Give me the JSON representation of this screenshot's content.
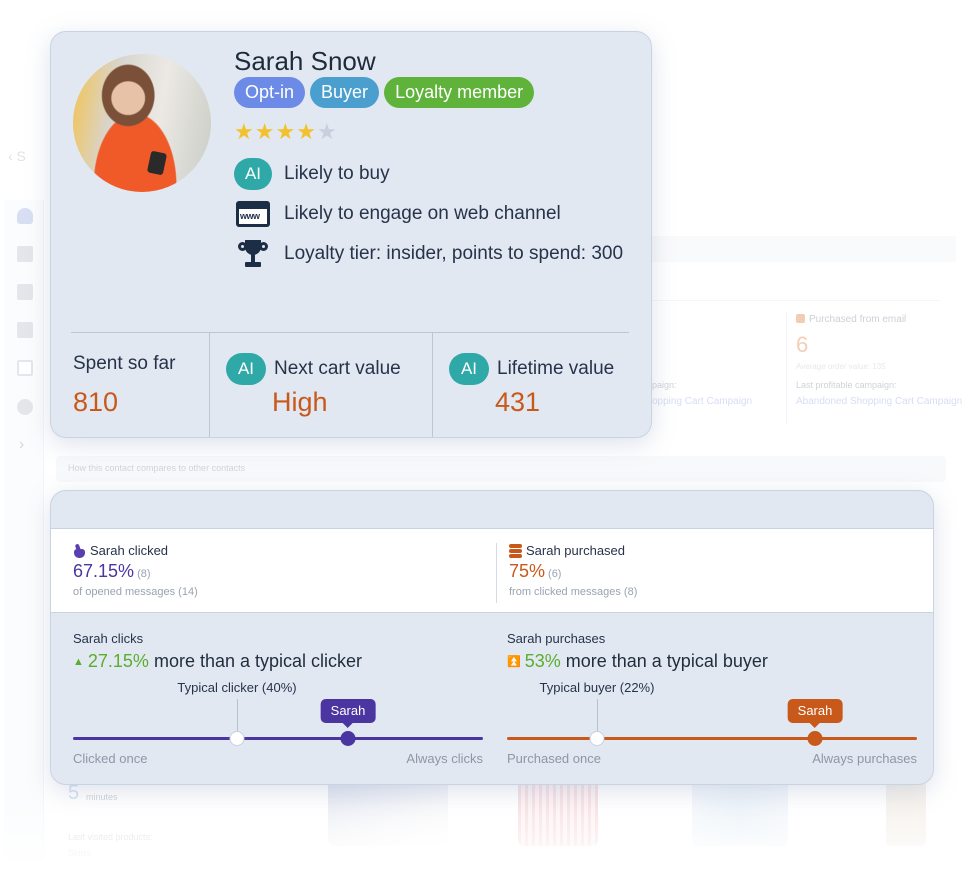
{
  "background": {
    "back_glyph": "‹ S",
    "sidebar_icons": [
      "contact-icon",
      "document-check-icon",
      "photo-document-icon",
      "building-icon",
      "file-text-icon",
      "globe-icon"
    ],
    "sidebar_expand": "›",
    "purchased_from_email": {
      "label": "Purchased from email",
      "value": "6",
      "avg_order": "Average order value: 135"
    },
    "last_profitable_campaign_label": "Last profitable campaign:",
    "last_profitable_campaign": "Abandoned Shopping Cart Campaign",
    "left_campaign_label": "paign:",
    "left_campaign": "opping Cart Campaign",
    "compare_heading": "How this contact compares to other contacts",
    "session": {
      "value": "5",
      "unit": "minutes"
    },
    "last_visited_label": "Last visited products:",
    "last_visited_category": "Skirts"
  },
  "profile": {
    "name": "Sarah Snow",
    "badges": [
      {
        "label": "Opt-in",
        "color": "#6c8be6"
      },
      {
        "label": "Buyer",
        "color": "#4a9fcf"
      },
      {
        "label": "Loyalty member",
        "color": "#5fb33a"
      }
    ],
    "rating": {
      "value": 4,
      "max": 5,
      "filled_color": "#f2c12e",
      "empty_color": "#c7d0dc"
    },
    "traits": [
      {
        "icon": "ai-badge-icon",
        "icon_text": "AI",
        "label": "Likely to buy"
      },
      {
        "icon": "web-browser-icon",
        "icon_text": "www",
        "label": "Likely to engage on web channel"
      },
      {
        "icon": "trophy-icon",
        "label": "Loyalty tier: insider, points to spend: 300"
      }
    ],
    "metrics": [
      {
        "label": "Spent so far",
        "value": "810",
        "ai": false
      },
      {
        "label": "Next cart value",
        "value": "High",
        "ai": true
      },
      {
        "label": "Lifetime value",
        "value": "431",
        "ai": true
      }
    ],
    "ai_label": "AI"
  },
  "comparison": {
    "clicked": {
      "title": "Sarah clicked",
      "percent": "67.15%",
      "count": "(8)",
      "sub": "of opened messages (14)",
      "color": "#4b35a0"
    },
    "purchased": {
      "title": "Sarah purchased",
      "percent": "75%",
      "count": "(6)",
      "sub": "from clicked messages (8)",
      "color": "#c8591a"
    },
    "click_slider": {
      "title": "Sarah clicks",
      "delta": "27.15%",
      "delta_text": "more than a typical clicker",
      "arrow": "▲",
      "typical_label": "Typical clicker (40%)",
      "typical_position": 0.4,
      "sarah_label": "Sarah",
      "sarah_position": 0.67,
      "min_label": "Clicked once",
      "max_label": "Always clicks",
      "color": "#4b35a0"
    },
    "purchase_slider": {
      "title": "Sarah purchases",
      "delta": "53%",
      "delta_text": "more than a typical buyer",
      "arrow": "⏫",
      "typical_label": "Typical buyer (22%)",
      "typical_position": 0.22,
      "sarah_label": "Sarah",
      "sarah_position": 0.75,
      "min_label": "Purchased once",
      "max_label": "Always purchases",
      "color": "#c8591a"
    }
  }
}
